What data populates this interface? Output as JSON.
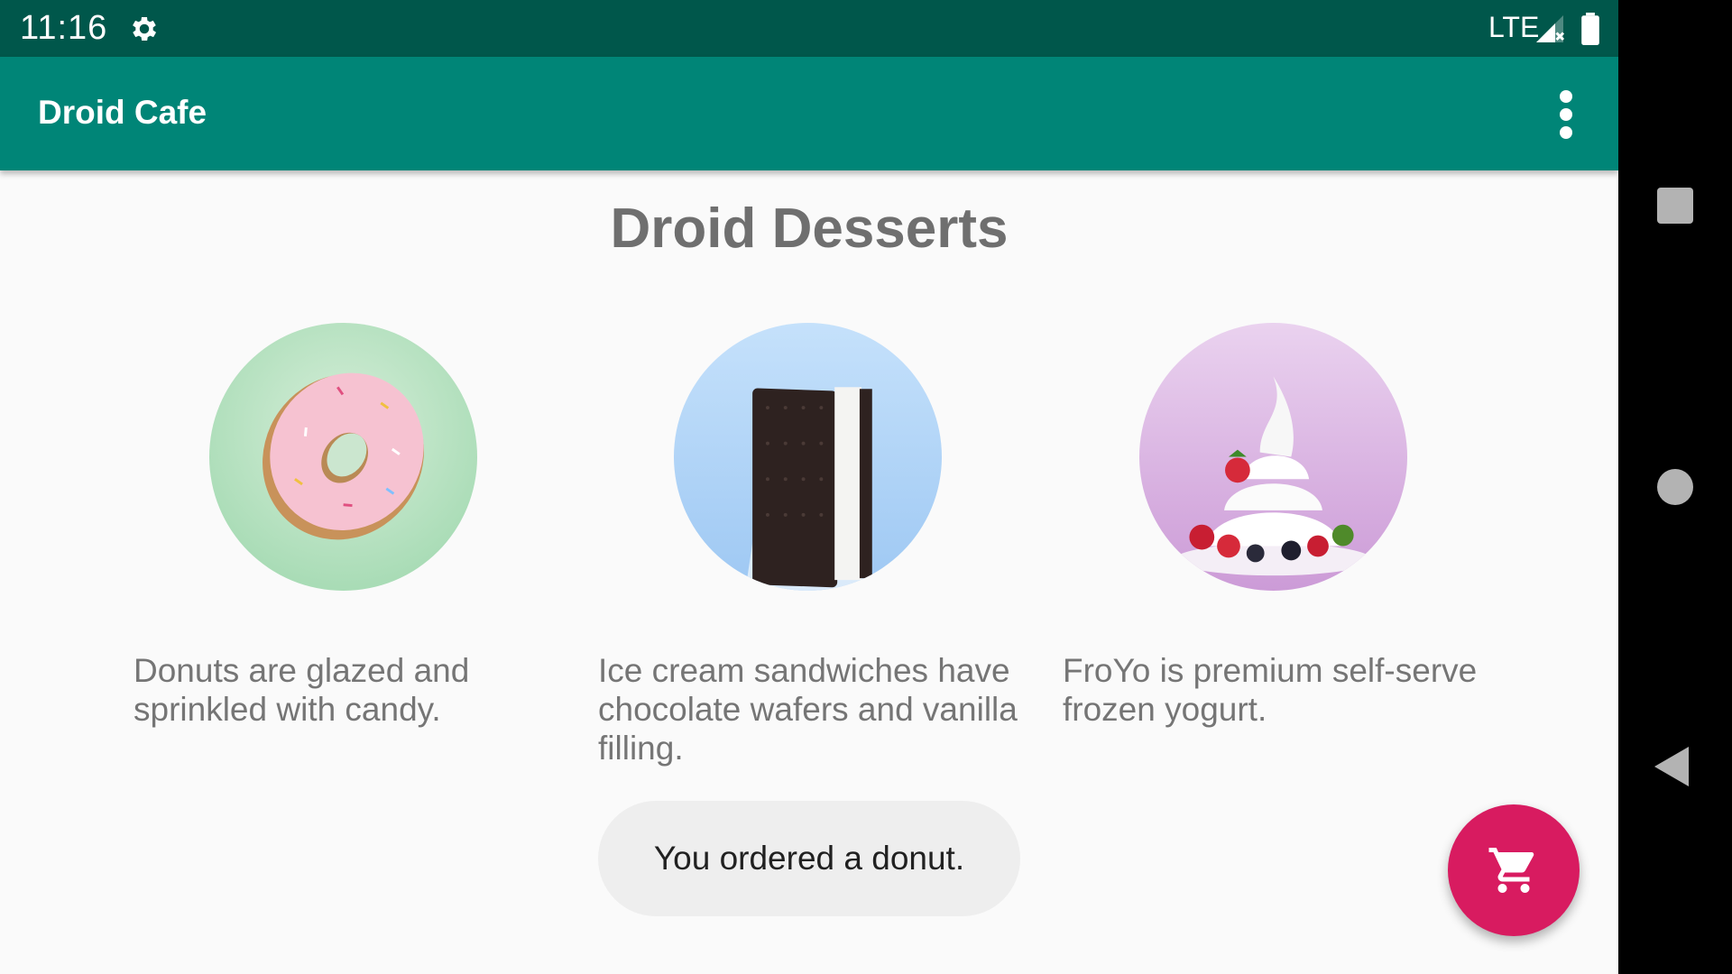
{
  "status_bar": {
    "time": "11:16",
    "network": "LTE",
    "icons": [
      "gear-icon",
      "signal-icon",
      "battery-icon"
    ]
  },
  "app_bar": {
    "title": "Droid Cafe",
    "menu_icon": "more-vert-icon"
  },
  "main": {
    "title": "Droid Desserts",
    "desserts": [
      {
        "image": "donut-image",
        "description": "Donuts are glazed and sprinkled with candy."
      },
      {
        "image": "ice-cream-sandwich-image",
        "description": "Ice cream sandwiches have chocolate wafers and vanilla filling."
      },
      {
        "image": "froyo-image",
        "description": "FroYo is premium self-serve frozen yogurt."
      }
    ],
    "toast": "You ordered a donut."
  },
  "fab": {
    "icon": "shopping-cart-icon"
  },
  "nav_bar": {
    "icons": [
      "recents-icon",
      "home-icon",
      "back-icon"
    ]
  },
  "colors": {
    "status_bar": "#00574b",
    "app_bar": "#008577",
    "fab": "#d81b60",
    "title_text": "#6f6f6f"
  }
}
